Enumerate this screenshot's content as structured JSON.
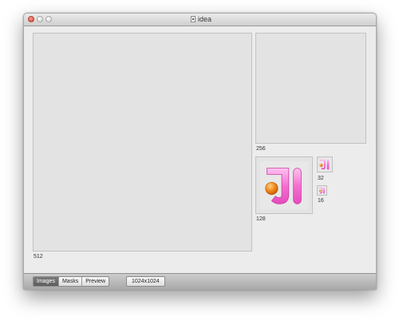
{
  "window": {
    "title": "idea",
    "title_icon": "document-icon"
  },
  "wells": {
    "large_label": "512",
    "medium_label": "256",
    "icon_128_label": "128",
    "icon_32_label": "32",
    "icon_16_label": "16"
  },
  "icon": {
    "glyph": "JI",
    "colors": {
      "letters": "#f56fd0",
      "letters_highlight": "#ffc3ef",
      "orb": "#f08a1c",
      "orb_highlight": "#ffd08a"
    }
  },
  "toolbar": {
    "segments": [
      {
        "label": "Images",
        "active": true
      },
      {
        "label": "Masks",
        "active": false
      },
      {
        "label": "Preview",
        "active": false
      }
    ],
    "resolution_label": "1024x1024"
  }
}
